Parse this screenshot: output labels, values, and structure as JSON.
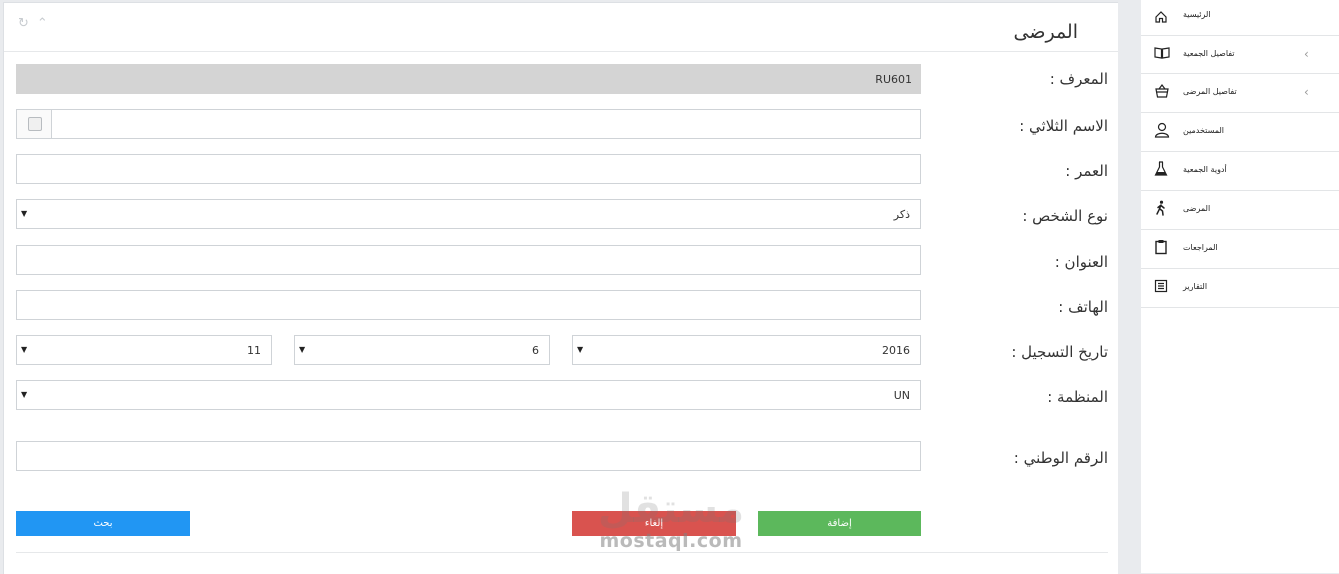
{
  "page": {
    "title": "المرضى"
  },
  "form": {
    "id_label": "المعرف :",
    "id_value": "RU601",
    "name_label": "الاسم الثلاثي :",
    "name_value": "",
    "age_label": "العمر :",
    "age_value": "",
    "gender_label": "نوع الشخص :",
    "gender_value": "ذكر",
    "address_label": "العنوان :",
    "address_value": "",
    "phone_label": "الهاتف :",
    "phone_value": "",
    "regdate_label": "تاريخ التسجيل :",
    "reg_year": "2016",
    "reg_month": "6",
    "reg_day": "11",
    "org_label": "المنظمة :",
    "org_value": "UN",
    "national_label": "الرقم الوطني :",
    "national_value": ""
  },
  "buttons": {
    "add": "إضافة",
    "cancel": "إلغاء",
    "search": "بحث"
  },
  "watermark": {
    "arabic": "مستقل",
    "latin": "mostaql.com"
  },
  "sidebar": {
    "items": [
      {
        "label": "الرئيسية",
        "icon": "home-icon",
        "has_children": false
      },
      {
        "label": "تفاصيل الجمعية",
        "icon": "book-icon",
        "has_children": true
      },
      {
        "label": "تفاصيل المرضى",
        "icon": "basket-icon",
        "has_children": true
      },
      {
        "label": "المستخدمين",
        "icon": "user-icon",
        "has_children": false
      },
      {
        "label": "أدوية الجمعية",
        "icon": "flask-icon",
        "has_children": false
      },
      {
        "label": "المرضى",
        "icon": "walking-person-icon",
        "has_children": false
      },
      {
        "label": "المراجعات",
        "icon": "clipboard-icon",
        "has_children": false
      },
      {
        "label": "التقارير",
        "icon": "report-list-icon",
        "has_children": false
      }
    ]
  },
  "colors": {
    "search": "#2196f3",
    "cancel": "#d9534f",
    "add": "#5cb85c",
    "readonly": "#d4d4d4"
  }
}
